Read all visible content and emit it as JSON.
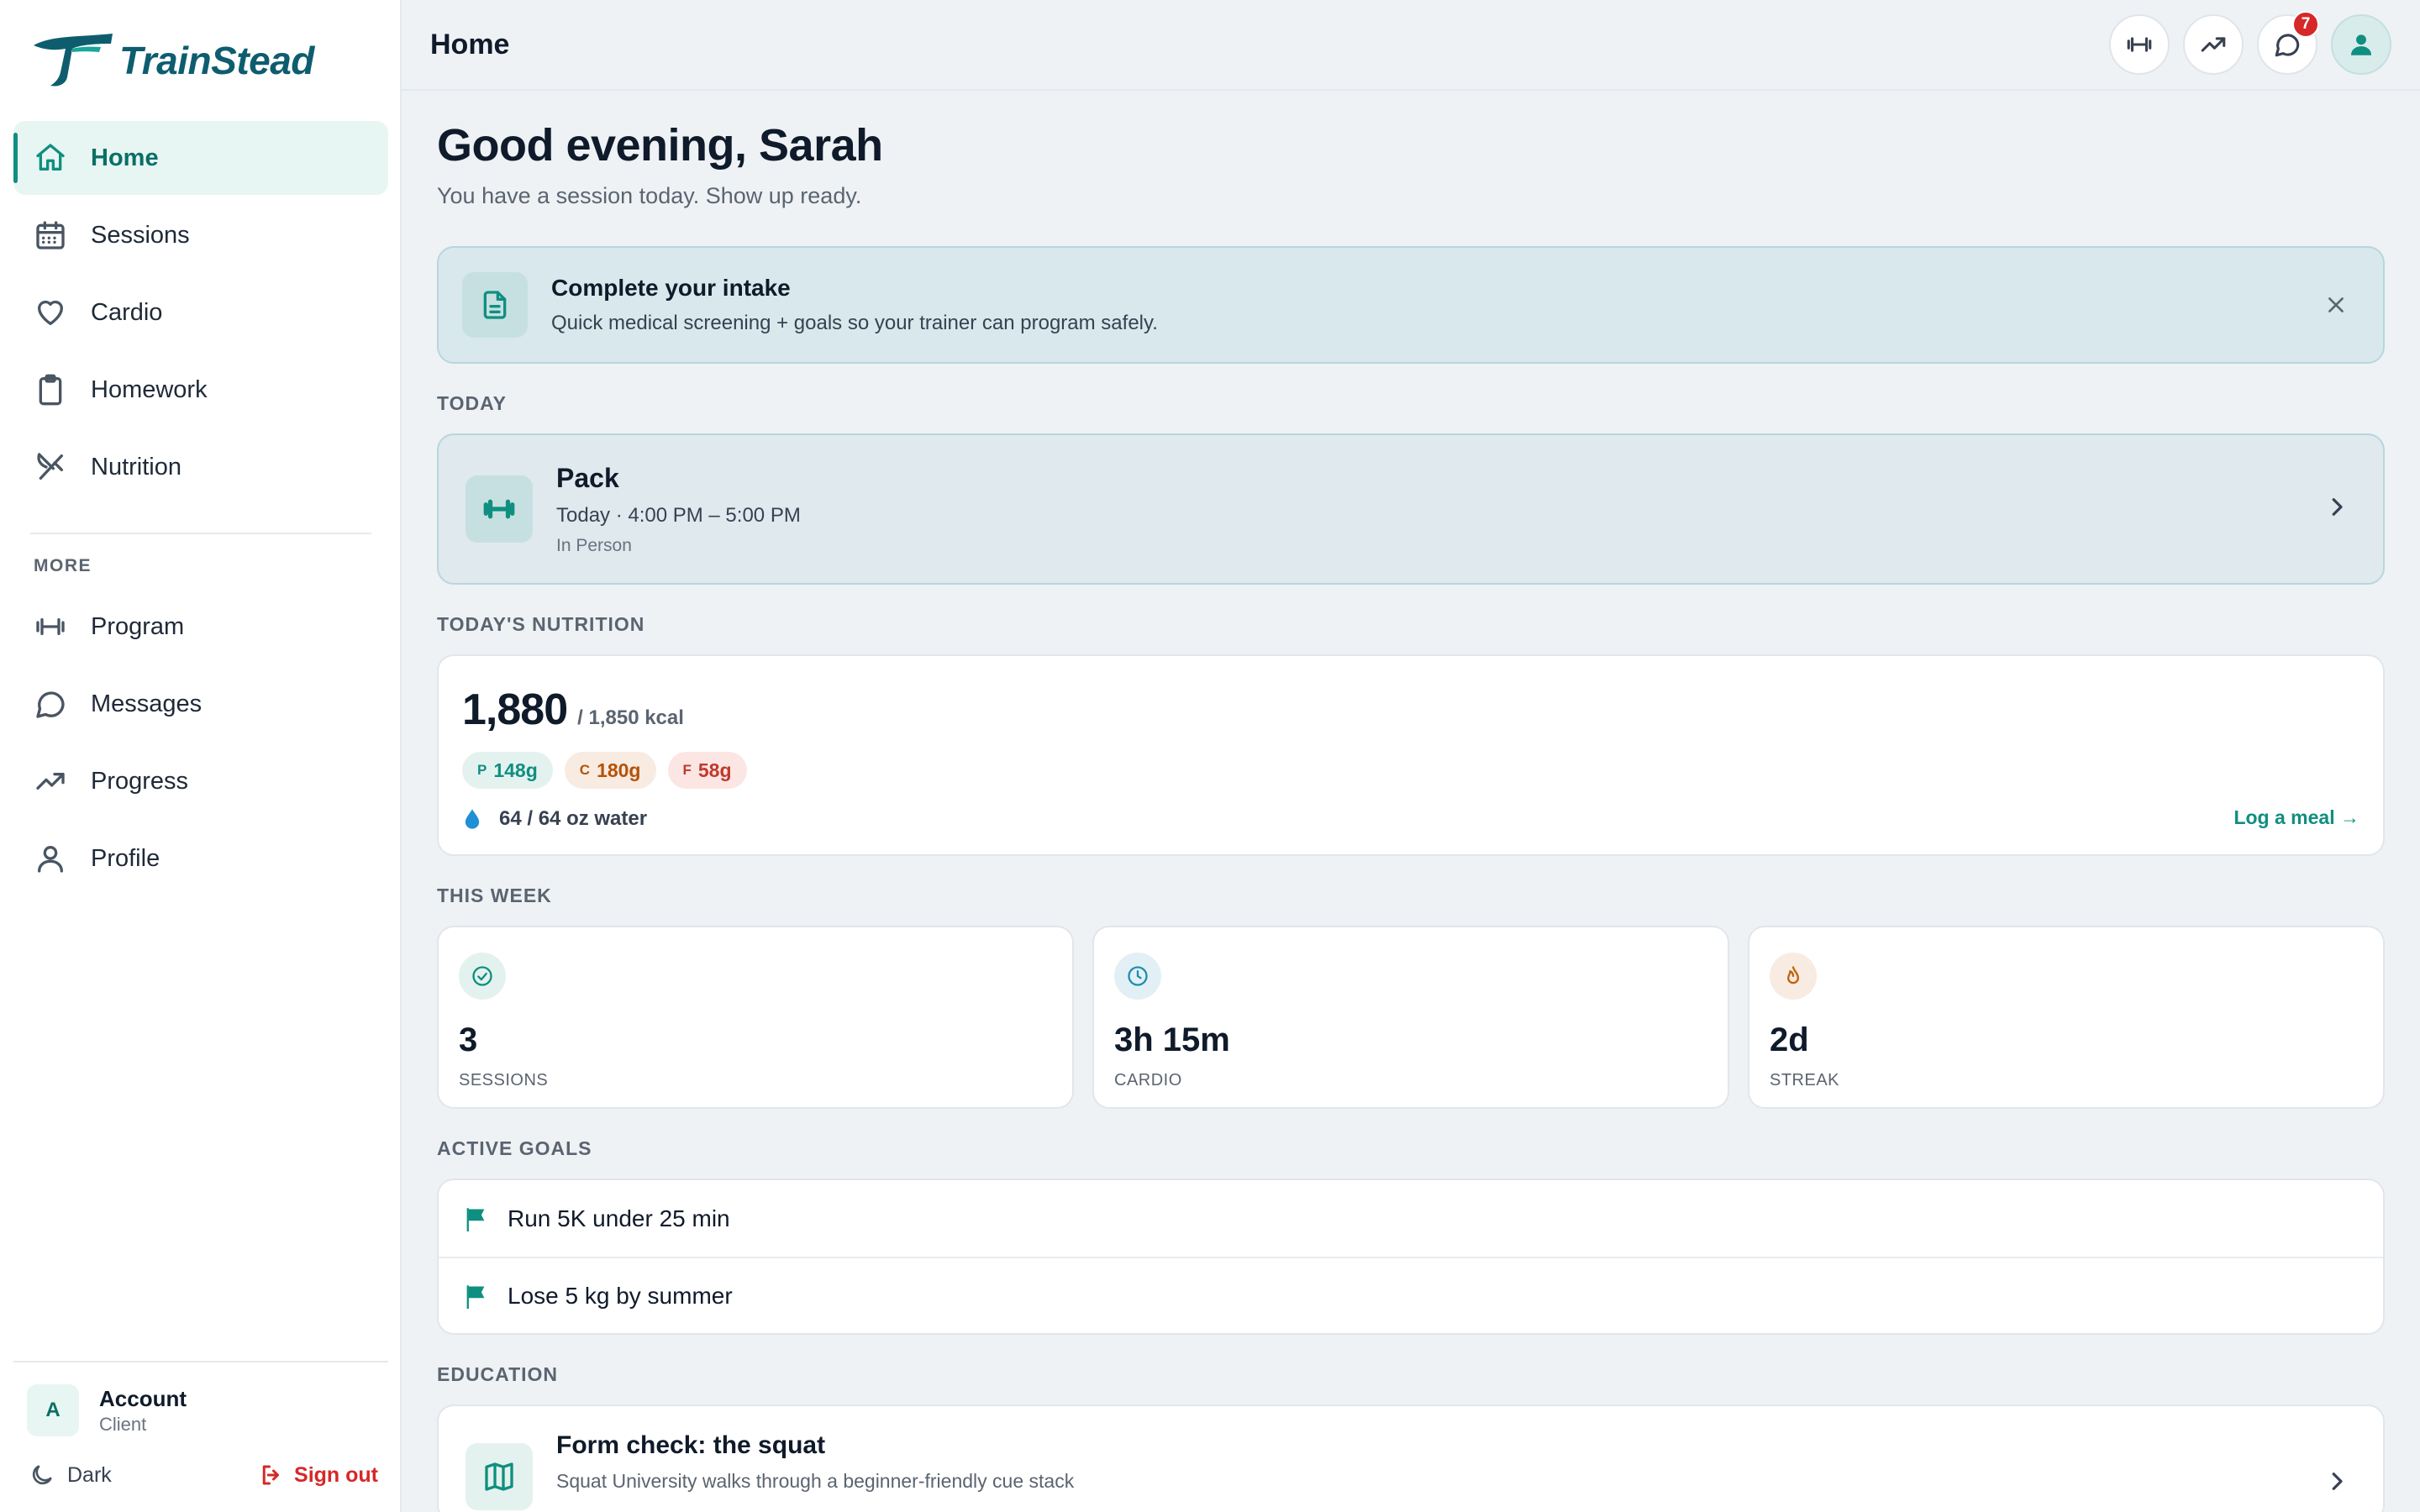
{
  "app": {
    "name": "TrainStead"
  },
  "colors": {
    "accent": "#0f8f80",
    "brand": "#0e5d6f",
    "danger": "#d62828"
  },
  "sidebar": {
    "nav": [
      {
        "label": "Home",
        "icon": "home-icon",
        "active": true
      },
      {
        "label": "Sessions",
        "icon": "calendar-icon"
      },
      {
        "label": "Cardio",
        "icon": "heart-icon"
      },
      {
        "label": "Homework",
        "icon": "clipboard-icon"
      },
      {
        "label": "Nutrition",
        "icon": "utensils-icon"
      }
    ],
    "more_label": "MORE",
    "more": [
      {
        "label": "Program",
        "icon": "dumbbell-icon"
      },
      {
        "label": "Messages",
        "icon": "message-icon"
      },
      {
        "label": "Progress",
        "icon": "trending-up-icon"
      },
      {
        "label": "Profile",
        "icon": "user-icon"
      }
    ],
    "account": {
      "initial": "A",
      "name": "Account",
      "role": "Client"
    },
    "dark_label": "Dark",
    "signout_label": "Sign out"
  },
  "topbar": {
    "title": "Home",
    "icons": [
      "dumbbell-icon",
      "trending-up-icon",
      "message-icon",
      "user-icon"
    ],
    "messages_badge": "7"
  },
  "greeting": {
    "title": "Good evening, Sarah",
    "subtitle": "You have a session today. Show up ready."
  },
  "intake": {
    "title": "Complete your intake",
    "description": "Quick medical screening + goals so your trainer can program safely."
  },
  "today": {
    "label": "TODAY",
    "session": {
      "title": "Pack",
      "time": "Today · 4:00 PM – 5:00 PM",
      "mode": "In Person"
    }
  },
  "nutrition": {
    "label": "TODAY'S NUTRITION",
    "calories": "1,880",
    "goal": "/ 1,850 kcal",
    "macros": [
      {
        "key": "P",
        "value": "148g"
      },
      {
        "key": "C",
        "value": "180g"
      },
      {
        "key": "F",
        "value": "58g"
      }
    ],
    "water": "64 / 64 oz water",
    "log_meal": "Log a meal →"
  },
  "week": {
    "label": "THIS WEEK",
    "stats": [
      {
        "value": "3",
        "label": "SESSIONS",
        "icon": "check-circle-icon"
      },
      {
        "value": "3h 15m",
        "label": "CARDIO",
        "icon": "clock-icon"
      },
      {
        "value": "2d",
        "label": "STREAK",
        "icon": "flame-icon"
      }
    ]
  },
  "goals": {
    "label": "ACTIVE GOALS",
    "items": [
      "Run 5K under 25 min",
      "Lose 5 kg by summer"
    ]
  },
  "education": {
    "label": "EDUCATION",
    "item": {
      "title": "Form check: the squat",
      "description": "Squat University walks through a beginner-friendly cue stack"
    }
  }
}
